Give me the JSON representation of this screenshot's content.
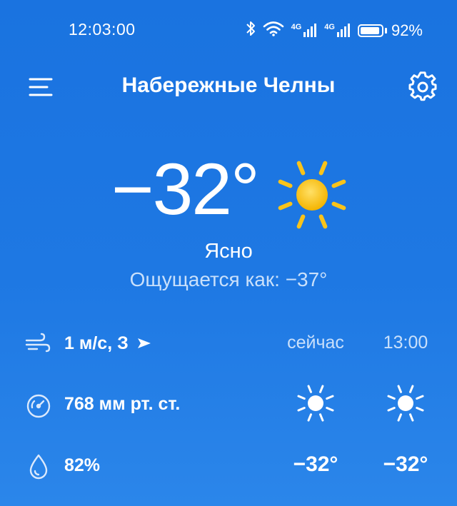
{
  "status_bar": {
    "time": "12:03:00",
    "network_1": "4G",
    "network_2": "4G",
    "battery_percent": "92%",
    "battery_level": 0.92
  },
  "header": {
    "city": "Набережные Челны",
    "menu_icon": "hamburger-menu-icon",
    "settings_icon": "gear-icon"
  },
  "current": {
    "temperature": "−32°",
    "condition": "Ясно",
    "feels_like": "Ощущается как: −37°",
    "icon": "sun-icon"
  },
  "details": {
    "wind_value": "1 м/с, З",
    "wind_icon": "wind-icon",
    "pressure_value": "768",
    "pressure_unit": "мм рт. ст.",
    "pressure_icon": "pressure-gauge-icon",
    "humidity_value": "82%",
    "humidity_icon": "humidity-drop-icon"
  },
  "forecast": [
    {
      "label": "сейчас",
      "icon": "sun-icon",
      "temperature": "−32°"
    },
    {
      "label": "13:00",
      "icon": "sun-icon",
      "temperature": "−32°"
    }
  ],
  "colors": {
    "background_top": "#1a73e0",
    "background_bottom": "#2b86ea",
    "sun_yellow": "#f9c31a",
    "muted_text": "#c9e0fb"
  }
}
